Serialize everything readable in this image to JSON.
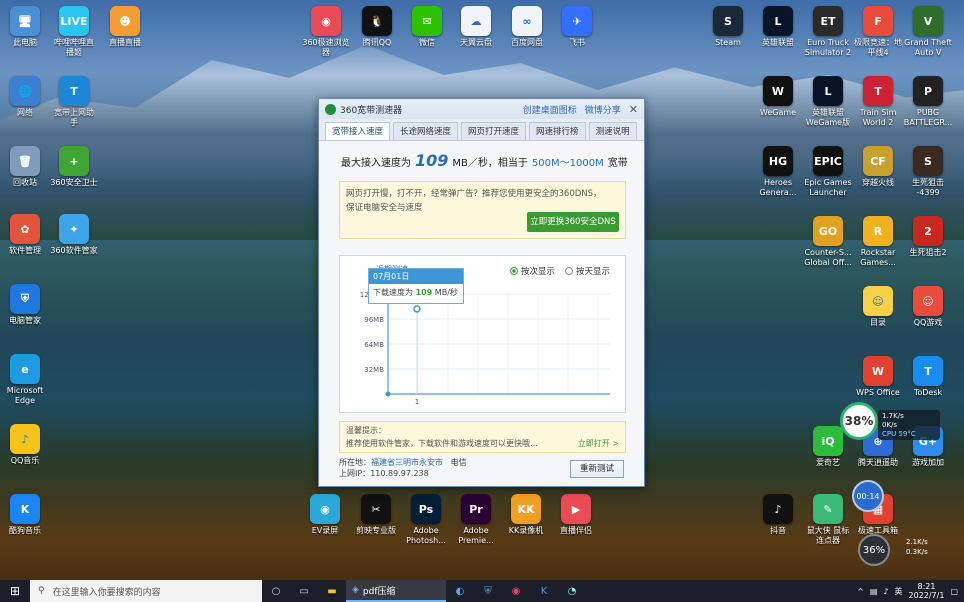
{
  "desktop": {
    "left_icons": [
      {
        "label": "此电脑",
        "icon": "computer-icon",
        "color": "#4a90d9",
        "glyph": "🖥"
      },
      {
        "label": "网络",
        "icon": "network-icon",
        "color": "#3b7fd1",
        "glyph": "🌐"
      },
      {
        "label": "回收站",
        "icon": "recycle-bin-icon",
        "color": "#7f9db8",
        "glyph": "🗑"
      },
      {
        "label": "软件管理",
        "icon": "software-manager-icon",
        "color": "#e0553c",
        "glyph": "✿"
      },
      {
        "label": "电脑管家",
        "icon": "pc-manager-icon",
        "color": "#1e78e0",
        "glyph": "⛨"
      },
      {
        "label": "Microsoft\nEdge",
        "icon": "edge-icon",
        "color": "#1e9be0",
        "glyph": "e"
      },
      {
        "label": "QQ音乐",
        "icon": "qq-music-icon",
        "color": "#f7c21a",
        "glyph": "♪"
      },
      {
        "label": "酷狗音乐",
        "icon": "kugou-icon",
        "color": "#1b86f2",
        "glyph": "K"
      }
    ],
    "second_col_icons": [
      {
        "label": "哔哩哔哩直\n播姬",
        "icon": "bilibili-live-icon",
        "color": "#2ec4f0",
        "glyph": "LIVE"
      },
      {
        "label": "宽带上网助\n手",
        "icon": "broadband-helper-icon",
        "color": "#1c87d6",
        "glyph": "T"
      },
      {
        "label": "360安全卫士",
        "icon": "360-security-icon",
        "color": "#3fa636",
        "glyph": "+"
      },
      {
        "label": "360软件管家",
        "icon": "360-software-icon",
        "color": "#3da4e8",
        "glyph": "✦"
      }
    ],
    "top_icons": [
      {
        "label": "直播直播",
        "icon": "live-app-icon",
        "color": "#f39c34",
        "glyph": "☻"
      },
      {
        "label": "360极速浏览\n器",
        "icon": "360-browser-icon",
        "color": "#e94b57",
        "glyph": "◉"
      },
      {
        "label": "腾讯QQ",
        "icon": "qq-icon",
        "color": "#111",
        "glyph": "🐧"
      },
      {
        "label": "微信",
        "icon": "wechat-icon",
        "color": "#2dc100",
        "glyph": "✉"
      },
      {
        "label": "天翼云盘",
        "icon": "tianyi-cloud-icon",
        "color": "#f0f4f8",
        "glyph": "☁"
      },
      {
        "label": "百度网盘",
        "icon": "baidu-pan-icon",
        "color": "#f0f4f8",
        "glyph": "∞"
      },
      {
        "label": "飞书",
        "icon": "feishu-icon",
        "color": "#3370ff",
        "glyph": "✈"
      }
    ],
    "right_icons": [
      {
        "label": "Steam",
        "icon": "steam-icon",
        "color": "#1b2838",
        "glyph": "S"
      },
      {
        "label": "英雄联盟",
        "icon": "lol-icon",
        "color": "#0a1428",
        "glyph": "L"
      },
      {
        "label": "Euro Truck\nSimulator 2",
        "icon": "euro-truck-icon",
        "color": "#2a2a2a",
        "glyph": "ET"
      },
      {
        "label": "极限竞速：地\n平线4",
        "icon": "forza-icon",
        "color": "#e94b3c",
        "glyph": "F"
      },
      {
        "label": "Grand Theft\nAuto V",
        "icon": "gta-icon",
        "color": "#2f6d2a",
        "glyph": "V"
      },
      {
        "label": "WeGame",
        "icon": "wegame-icon",
        "color": "#111",
        "glyph": "W"
      },
      {
        "label": "英雄联盟\nWeGame版",
        "icon": "lol-wegame-icon",
        "color": "#0a1428",
        "glyph": "L"
      },
      {
        "label": "Train Sim\nWorld 2",
        "icon": "train-sim-icon",
        "color": "#c23",
        "glyph": "T"
      },
      {
        "label": "PUBG\nBATTLEGR...",
        "icon": "pubg-icon",
        "color": "#222",
        "glyph": "P"
      },
      {
        "label": "Heroes\nGenera...",
        "icon": "heroes-icon",
        "color": "#111",
        "glyph": "HG"
      },
      {
        "label": "Epic Games\nLauncher",
        "icon": "epic-icon",
        "color": "#111",
        "glyph": "EPIC"
      },
      {
        "label": "穿越火线",
        "icon": "crossfire-icon",
        "color": "#c8a030",
        "glyph": "CF"
      },
      {
        "label": "生死狙击\n-4399",
        "icon": "shengsi-icon",
        "color": "#3a2a20",
        "glyph": "S"
      },
      {
        "label": "Counter-S...\nGlobal Off...",
        "icon": "csgo-icon",
        "color": "#e0a020",
        "glyph": "GO"
      },
      {
        "label": "Rockstar\nGames...",
        "icon": "rockstar-icon",
        "color": "#f0b020",
        "glyph": "R"
      },
      {
        "label": "生死狙击2",
        "icon": "shengsi2-icon",
        "color": "#c8281e",
        "glyph": "2"
      },
      {
        "label": "目录",
        "icon": "directory-icon",
        "color": "#f7d046",
        "glyph": "☺"
      },
      {
        "label": "QQ游戏",
        "icon": "qq-game-icon",
        "color": "#e94b3c",
        "glyph": "☺"
      },
      {
        "label": "WPS Office",
        "icon": "wps-icon",
        "color": "#e0402f",
        "glyph": "W"
      },
      {
        "label": "ToDesk",
        "icon": "todesk-icon",
        "color": "#1a8cf0",
        "glyph": "T"
      },
      {
        "label": "爱奇艺",
        "icon": "iqiyi-icon",
        "color": "#2dbb3c",
        "glyph": "iQ"
      },
      {
        "label": "腾天逍遥助",
        "icon": "helper-icon",
        "color": "#2f6bd6",
        "glyph": "⊕"
      },
      {
        "label": "游戏加加",
        "icon": "game-plus-icon",
        "color": "#2f8cf0",
        "glyph": "G+"
      },
      {
        "label": "抖音",
        "icon": "douyin-icon",
        "color": "#111",
        "glyph": "♪"
      },
      {
        "label": "鼠大侠 鼠标\n连点器",
        "icon": "mouse-clicker-icon",
        "color": "#3cb878",
        "glyph": "✎"
      },
      {
        "label": "极速工具箱",
        "icon": "toolbox-icon",
        "color": "#e0402f",
        "glyph": "▦"
      }
    ],
    "bottom_icons": [
      {
        "label": "EV录屏",
        "icon": "ev-recorder-icon",
        "color": "#2aa8d8",
        "glyph": "◉"
      },
      {
        "label": "剪映专业版",
        "icon": "jianying-icon",
        "color": "#111",
        "glyph": "✂"
      },
      {
        "label": "Adobe\nPhotosh...",
        "icon": "photoshop-icon",
        "color": "#001e36",
        "glyph": "Ps"
      },
      {
        "label": "Adobe\nPremie...",
        "icon": "premiere-icon",
        "color": "#2a0033",
        "glyph": "Pr"
      },
      {
        "label": "KK录像机",
        "icon": "kk-recorder-icon",
        "color": "#f0a020",
        "glyph": "KK"
      },
      {
        "label": "直播伴侣",
        "icon": "live-companion-icon",
        "color": "#e94b57",
        "glyph": "▶"
      }
    ]
  },
  "window": {
    "title": "360宽带测速器",
    "link_shortcut": "创建桌面图标",
    "link_share": "微博分享",
    "tabs": [
      "宽带接入速度",
      "长途网络速度",
      "网页打开速度",
      "网速排行榜",
      "测速说明"
    ],
    "speed_prefix": "最大接入速度为",
    "speed_value": "109",
    "speed_unit": "MB／秒，相当于",
    "speed_equiv": "500M～1000M",
    "speed_suffix": "宽带",
    "dns_line1": "网页打开慢，打不开，经常弹广告？推荐您使用更安全的360DNS，",
    "dns_line2": "保证电脑安全与速度",
    "dns_button": "立即更换360安全DNS",
    "chart_title": "近期测速",
    "radio_by_count": "按次显示",
    "radio_by_day": "按天显示",
    "tooltip_date": "07月01日",
    "tooltip_prefix": "下载速度为",
    "tooltip_value": "109",
    "tooltip_unit": "MB/秒",
    "tip_title": "温馨提示：",
    "tip_text": "推荐使用软件管家，下载软件和游戏速度可以更快哦…",
    "tip_link": "立即打开 >",
    "loc_label": "所在地：",
    "loc_value": "福建省三明市永安市",
    "loc_isp": "电信",
    "ip_label": "上网IP：",
    "ip_value": "110.89.97.238",
    "retest_button": "重新测试"
  },
  "chart_data": {
    "type": "line",
    "x": [
      1
    ],
    "y": [
      109
    ],
    "yticks": [
      "128MB",
      "96MB",
      "64MB",
      "32MB"
    ],
    "xticks": [
      "1"
    ],
    "ylim": [
      0,
      128
    ],
    "grid": true
  },
  "widgets": {
    "float_percent": "38%",
    "upload_rate": "1.7K/s",
    "download_rate": "0K/s",
    "cpu_label": "CPU 59°C",
    "timer": "00:14",
    "memory_percent": "36%",
    "net_up": "2.1K/s",
    "net_down": "0.3K/s"
  },
  "taskbar": {
    "search_placeholder": "在这里输入你要搜索的内容",
    "active_task": "pdf压缩",
    "ime": "英",
    "time": "8:21",
    "date": "2022/7/1"
  }
}
